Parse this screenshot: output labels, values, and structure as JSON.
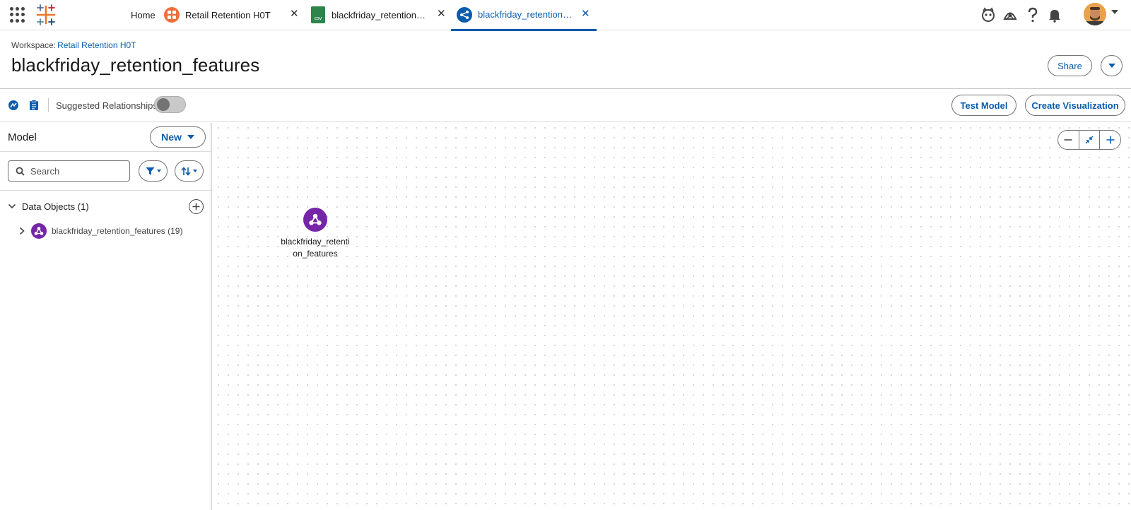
{
  "tabs": {
    "home_label": "Home",
    "retail_label": "Retail Retention H0T",
    "csv_label": "blackfriday_retention_fe...",
    "csv_icon_text": "csv",
    "model_label": "blackfriday_retention_fe...",
    "close_glyph": "✕"
  },
  "header": {
    "workspace_prefix": "Workspace:",
    "workspace_link": "Retail Retention H0T",
    "title": "blackfriday_retention_features",
    "share_label": "Share"
  },
  "toolbar": {
    "suggested_label": "Suggested Relationships",
    "suggested_enabled": false,
    "test_label": "Test Model",
    "create_label": "Create Visualization"
  },
  "panel": {
    "title": "Model",
    "new_label": "New",
    "search_placeholder": "Search",
    "section_label": "Data Objects (1)",
    "objects": [
      {
        "label": "blackfriday_retention_features (19)"
      }
    ]
  },
  "canvas": {
    "node_label": "blackfriday_retention_features"
  },
  "colors": {
    "brand_blue": "#0b5cab",
    "object_purple": "#7526a8",
    "retail_orange": "#f26d3a",
    "csv_green": "#2e844a"
  },
  "icons": [
    "app-launcher-icon",
    "tableau-logo-icon",
    "agent-icon",
    "trailhead-icon",
    "help-icon",
    "bell-icon",
    "filter-icon",
    "sort-icon",
    "search-icon",
    "chevron-down-icon",
    "chevron-right-icon",
    "add-icon",
    "zoom-out-icon",
    "fit-icon",
    "zoom-in-icon"
  ]
}
